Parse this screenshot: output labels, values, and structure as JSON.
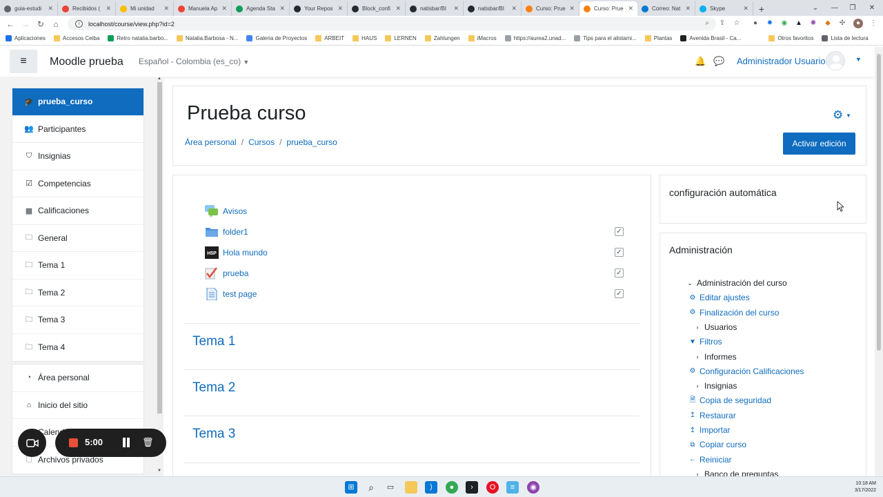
{
  "browser": {
    "tabs": [
      {
        "label": "guia-estudi",
        "color": "#5f6368",
        "active": false
      },
      {
        "label": "Recibidos (",
        "color": "#ea4335",
        "active": false
      },
      {
        "label": "Mi unidad",
        "color": "#fbbc04",
        "active": false
      },
      {
        "label": "Manuela Ap",
        "color": "#ea4335",
        "active": false
      },
      {
        "label": "Agenda Sta",
        "color": "#0f9d58",
        "active": false
      },
      {
        "label": "Your Repos",
        "color": "#24292f",
        "active": false
      },
      {
        "label": "Block_confi",
        "color": "#24292f",
        "active": false
      },
      {
        "label": "natisbar/Bl",
        "color": "#24292f",
        "active": false
      },
      {
        "label": "natisbar/Bl",
        "color": "#24292f",
        "active": false
      },
      {
        "label": "Curso: Prue",
        "color": "#f98012",
        "active": false
      },
      {
        "label": "Curso: Prue",
        "color": "#f98012",
        "active": true
      },
      {
        "label": "Correo: Nat",
        "color": "#0078d4",
        "active": false
      },
      {
        "label": "Skype",
        "color": "#00aff0",
        "active": false
      }
    ],
    "new_tab": "+",
    "url": "localhost/course/view.php?id=2",
    "bookmarks": [
      {
        "label": "Aplicaciones",
        "kind": "apps"
      },
      {
        "label": "Accesos Ceiba",
        "kind": "folder"
      },
      {
        "label": "Retro natalia.barbo...",
        "kind": "green"
      },
      {
        "label": "Natalia.Barbosa - N...",
        "kind": "folder"
      },
      {
        "label": "Galeria de Proyectos",
        "kind": "google"
      },
      {
        "label": "ARBEIT",
        "kind": "folder"
      },
      {
        "label": "HAUS",
        "kind": "folder"
      },
      {
        "label": "LERNEN",
        "kind": "folder"
      },
      {
        "label": "Zahlungen",
        "kind": "folder"
      },
      {
        "label": "iMacros",
        "kind": "folder"
      },
      {
        "label": "https://aurea2.unad...",
        "kind": "page"
      },
      {
        "label": "Tips para el alistami...",
        "kind": "page"
      },
      {
        "label": "Plantas",
        "kind": "folder"
      },
      {
        "label": "Avenida Brasil - Ca...",
        "kind": "dark"
      },
      {
        "label": "Otros favoritos",
        "kind": "folder"
      },
      {
        "label": "Lista de lectura",
        "kind": "list"
      }
    ]
  },
  "navbar": {
    "site_name": "Moodle prueba",
    "language": "Español - Colombia (es_co)",
    "user_name": "Administrador Usuario"
  },
  "drawer": {
    "group1": [
      {
        "label": "prueba_curso",
        "icon": "graduation-cap-icon",
        "glyph": "🎓",
        "active": true
      },
      {
        "label": "Participantes",
        "icon": "users-icon",
        "glyph": "👥",
        "active": false
      },
      {
        "label": "Insignias",
        "icon": "shield-icon",
        "glyph": "⛉",
        "active": false
      },
      {
        "label": "Competencias",
        "icon": "check-square-icon",
        "glyph": "☑",
        "active": false
      },
      {
        "label": "Calificaciones",
        "icon": "table-icon",
        "glyph": "▦",
        "active": false
      },
      {
        "label": "General",
        "icon": "folder-icon",
        "glyph": "🗀",
        "active": false
      },
      {
        "label": "Tema 1",
        "icon": "folder-icon",
        "glyph": "🗀",
        "active": false
      },
      {
        "label": "Tema 2",
        "icon": "folder-icon",
        "glyph": "🗀",
        "active": false
      },
      {
        "label": "Tema 3",
        "icon": "folder-icon",
        "glyph": "🗀",
        "active": false
      },
      {
        "label": "Tema 4",
        "icon": "folder-icon",
        "glyph": "🗀",
        "active": false
      }
    ],
    "group2": [
      {
        "label": "Área personal",
        "icon": "dashboard-icon",
        "glyph": "◔"
      },
      {
        "label": "Inicio del sitio",
        "icon": "home-icon",
        "glyph": "⌂"
      },
      {
        "label": "Calendario",
        "icon": "calendar-icon",
        "glyph": "▤"
      },
      {
        "label": "Archivos privados",
        "icon": "file-icon",
        "glyph": "🗋"
      }
    ]
  },
  "course": {
    "title": "Prueba curso",
    "breadcrumb": [
      "Área personal",
      "Cursos",
      "prueba_curso"
    ],
    "edit_button": "Activar edición",
    "activities": [
      {
        "label": "Avisos",
        "icon": "forum-icon",
        "completion": false
      },
      {
        "label": "folder1",
        "icon": "folder-icon",
        "completion": true
      },
      {
        "label": "Hola mundo",
        "icon": "h5p-icon",
        "completion": true
      },
      {
        "label": "prueba",
        "icon": "assignment-icon",
        "completion": true
      },
      {
        "label": "test page",
        "icon": "page-icon",
        "completion": true
      }
    ],
    "sections": [
      "Tema 1",
      "Tema 2",
      "Tema 3"
    ],
    "completion_mark": "✓"
  },
  "blocks": {
    "auto_config_title": "configuración automática",
    "admin_title": "Administración",
    "admin_tree": [
      {
        "label": "Administración del curso",
        "kind": "plain-open",
        "glyph": "⌄"
      },
      {
        "label": "Editar ajustes",
        "kind": "link",
        "glyph": "⚙",
        "icon": "gear-icon"
      },
      {
        "label": "Finalización del curso",
        "kind": "link",
        "glyph": "⚙",
        "icon": "gear-icon"
      },
      {
        "label": "Usuarios",
        "kind": "plain",
        "glyph": "›"
      },
      {
        "label": "Filtros",
        "kind": "link",
        "glyph": "▼",
        "icon": "filter-icon"
      },
      {
        "label": "Informes",
        "kind": "plain",
        "glyph": "›"
      },
      {
        "label": "Configuración Calificaciones",
        "kind": "link",
        "glyph": "⚙",
        "icon": "gear-icon"
      },
      {
        "label": "Insignias",
        "kind": "plain",
        "glyph": "›"
      },
      {
        "label": "Copia de seguridad",
        "kind": "link",
        "glyph": "🗎",
        "icon": "backup-icon"
      },
      {
        "label": "Restaurar",
        "kind": "link",
        "glyph": "↥",
        "icon": "restore-icon"
      },
      {
        "label": "Importar",
        "kind": "link",
        "glyph": "↥",
        "icon": "import-icon"
      },
      {
        "label": "Copiar curso",
        "kind": "link",
        "glyph": "⧉",
        "icon": "copy-icon"
      },
      {
        "label": "Reiniciar",
        "kind": "link",
        "glyph": "←",
        "icon": "reset-icon"
      },
      {
        "label": "Banco de preguntas",
        "kind": "plain",
        "glyph": "›"
      }
    ]
  },
  "recorder": {
    "time": "5:00"
  },
  "taskbar": {
    "time": "10:18 AM",
    "date": "3/17/2022"
  },
  "colors": {
    "brand": "#0f6cbf",
    "text": "#1d2125",
    "drawer_bg": "#f2f2f2"
  }
}
